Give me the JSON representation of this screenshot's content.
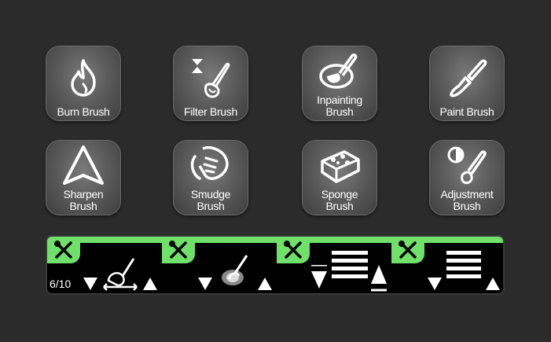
{
  "brushes": [
    {
      "name": "Burn Brush",
      "icon": "flame-icon"
    },
    {
      "name": "Filter Brush",
      "icon": "filter-brush-icon"
    },
    {
      "name": "Inpainting\nBrush",
      "icon": "inpainting-brush-icon"
    },
    {
      "name": "Paint Brush",
      "icon": "paint-brush-icon"
    },
    {
      "name": "Sharpen\nBrush",
      "icon": "sharpen-triangle-icon"
    },
    {
      "name": "Smudge\nBrush",
      "icon": "smudge-hand-icon"
    },
    {
      "name": "Sponge\nBrush",
      "icon": "sponge-icon"
    },
    {
      "name": "Adjustment\nBrush",
      "icon": "adjustment-brush-icon"
    }
  ],
  "toolbar": {
    "counter": "6/10",
    "accent_color": "#6fe06a"
  }
}
